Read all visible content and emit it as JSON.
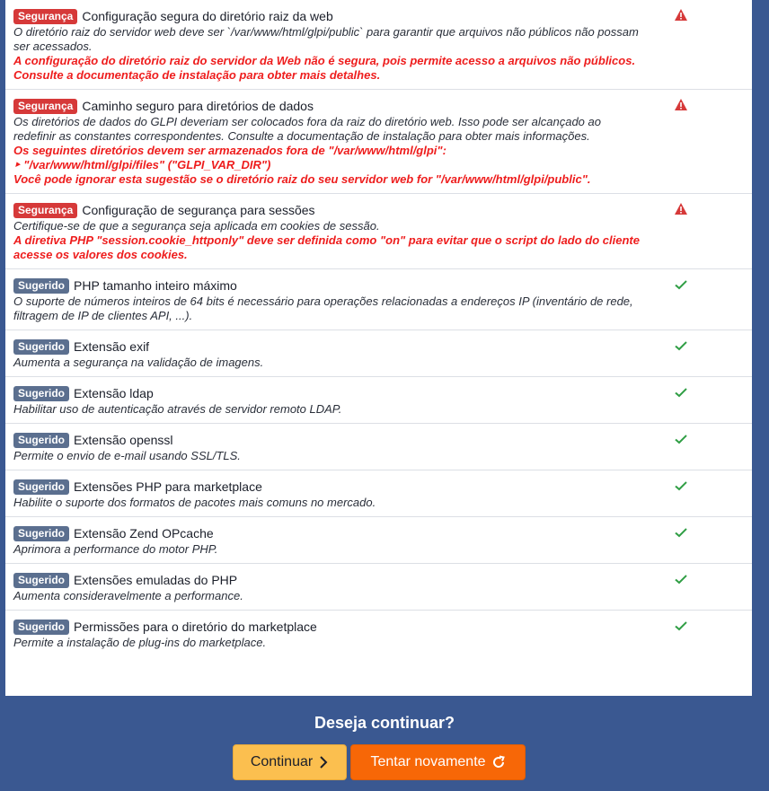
{
  "rows": [
    {
      "badge": "Segurança",
      "title": "Configuração segura do diretório raiz da web",
      "desc": "O diretório raiz do servidor web deve ser `/var/www/html/glpi/public` para garantir que arquivos não públicos não possam ser acessados.",
      "warn": "A configuração do diretório raiz do servidor da Web não é segura, pois permite acesso a arquivos não públicos. Consulte a documentação de instalação para obter mais detalhes."
    },
    {
      "badge": "Segurança",
      "title": "Caminho seguro para diretórios de dados",
      "desc": "Os diretórios de dados do GLPI deveriam ser colocados fora da raiz do diretório web. Isso pode ser alcançado ao redefinir as constantes correspondentes. Consulte a documentação de instalação para obter mais informações.",
      "warn": "Os seguintes diretórios devem ser armazenados fora de \"/var/www/html/glpi\":\n‣ \"/var/www/html/glpi/files\" (\"GLPI_VAR_DIR\")\nVocê pode ignorar esta sugestão se o diretório raiz do seu servidor web for \"/var/www/html/glpi/public\"."
    },
    {
      "badge": "Segurança",
      "title": "Configuração de segurança para sessões",
      "desc": "Certifique-se de que a segurança seja aplicada em cookies de sessão.",
      "warn": "A diretiva PHP \"session.cookie_httponly\" deve ser definida como \"on\" para evitar que o script do lado do cliente acesse os valores dos cookies."
    },
    {
      "badge": "Sugerido",
      "title": "PHP tamanho inteiro máximo",
      "desc": "O suporte de números inteiros de 64 bits é necessário para operações relacionadas a endereços IP (inventário de rede, filtragem de IP de clientes API, ...)."
    },
    {
      "badge": "Sugerido",
      "title": "Extensão exif",
      "desc": "Aumenta a segurança na validação de imagens."
    },
    {
      "badge": "Sugerido",
      "title": "Extensão ldap",
      "desc": "Habilitar uso de autenticação através de servidor remoto LDAP."
    },
    {
      "badge": "Sugerido",
      "title": "Extensão openssl",
      "desc": "Permite o envio de e-mail usando SSL/TLS."
    },
    {
      "badge": "Sugerido",
      "title": "Extensões PHP para marketplace",
      "desc": "Habilite o suporte dos formatos de pacotes mais comuns no mercado."
    },
    {
      "badge": "Sugerido",
      "title": "Extensão Zend OPcache",
      "desc": "Aprimora a performance do motor PHP."
    },
    {
      "badge": "Sugerido",
      "title": "Extensões emuladas do PHP",
      "desc": "Aumenta consideravelmente a performance."
    },
    {
      "badge": "Sugerido",
      "title": "Permissões para o diretório do marketplace",
      "desc": "Permite a instalação de plug-ins do marketplace."
    }
  ],
  "footer": {
    "question": "Deseja continuar?",
    "continue_label": "Continuar",
    "retry_label": "Tentar novamente"
  },
  "colors": {
    "security_badge": "#d63939",
    "suggested_badge": "#5b6f8f",
    "warning_text": "#ee1d1d",
    "ok_check": "#2f9e44",
    "background": "#3a5891",
    "continue_button": "#fbbf4f",
    "retry_button": "#f76707"
  },
  "icons": {
    "security_status": "warning-triangle-icon",
    "suggested_status": "check-icon",
    "continue": "chevron-right-icon",
    "retry": "refresh-icon"
  }
}
